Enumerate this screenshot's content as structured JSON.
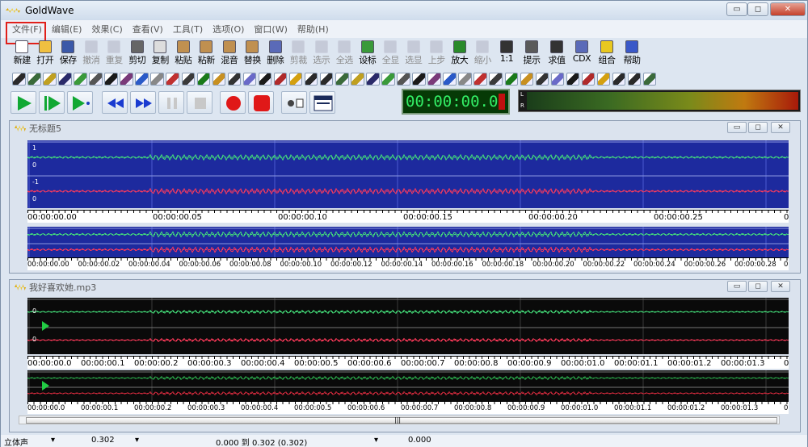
{
  "app": {
    "title": "GoldWave"
  },
  "window_controls": {
    "minimize": "▭",
    "restore": "◻",
    "close": "✕"
  },
  "menu": [
    "文件(F)",
    "编辑(E)",
    "效果(C)",
    "查看(V)",
    "工具(T)",
    "选项(O)",
    "窗口(W)",
    "帮助(H)"
  ],
  "toolbar": [
    {
      "label": "新建",
      "icon": "new-icon",
      "enabled": true
    },
    {
      "label": "打开",
      "icon": "open-icon",
      "enabled": true
    },
    {
      "label": "保存",
      "icon": "save-icon",
      "enabled": true
    },
    {
      "label": "撤消",
      "icon": "undo-icon",
      "enabled": false
    },
    {
      "label": "重复",
      "icon": "redo-icon",
      "enabled": false
    },
    {
      "label": "剪切",
      "icon": "cut-icon",
      "enabled": true
    },
    {
      "label": "复制",
      "icon": "copy-icon",
      "enabled": true
    },
    {
      "label": "粘贴",
      "icon": "paste-icon",
      "enabled": true
    },
    {
      "label": "粘新",
      "icon": "paste-new-icon",
      "enabled": true
    },
    {
      "label": "混音",
      "icon": "mix-icon",
      "enabled": true
    },
    {
      "label": "替换",
      "icon": "replace-icon",
      "enabled": true
    },
    {
      "label": "删除",
      "icon": "delete-icon",
      "enabled": true
    },
    {
      "label": "剪裁",
      "icon": "trim-icon",
      "enabled": false
    },
    {
      "label": "选示",
      "icon": "select-view-icon",
      "enabled": false
    },
    {
      "label": "全选",
      "icon": "select-all-icon",
      "enabled": false
    },
    {
      "label": "设标",
      "icon": "set-marker-icon",
      "enabled": true
    },
    {
      "label": "全显",
      "icon": "show-all-icon",
      "enabled": false
    },
    {
      "label": "选显",
      "icon": "show-selection-icon",
      "enabled": false
    },
    {
      "label": "上步",
      "icon": "previous-icon",
      "enabled": false
    },
    {
      "label": "放大",
      "icon": "zoom-in-icon",
      "enabled": true
    },
    {
      "label": "缩小",
      "icon": "zoom-out-icon",
      "enabled": false
    },
    {
      "label": "1:1",
      "icon": "zoom-1-1-icon",
      "enabled": true
    },
    {
      "label": "提示",
      "icon": "cue-icon",
      "enabled": true
    },
    {
      "label": "求值",
      "icon": "evaluate-icon",
      "enabled": true
    },
    {
      "label": "CDX",
      "icon": "cd-icon",
      "enabled": true
    },
    {
      "label": "组合",
      "icon": "combine-icon",
      "enabled": true
    },
    {
      "label": "帮助",
      "icon": "help-icon",
      "enabled": true
    }
  ],
  "effects_toolbar_count": 42,
  "timer": {
    "display": "00:00:00.0"
  },
  "meter": {
    "left": "L",
    "right": "R"
  },
  "windows": [
    {
      "title": "无标题5",
      "ch_labels": [
        "1",
        "0",
        "-1",
        "0"
      ],
      "ruler": [
        "00:00:00.00",
        "00:00:00.05",
        "00:00:00.10",
        "00:00:00.15",
        "00:00:00.20",
        "00:00:00.25",
        "0"
      ],
      "overview_ruler": [
        "00:00:00.00",
        "00:00:00.02",
        "00:00:00.04",
        "00:00:00.06",
        "00:00:00.08",
        "00:00:00.10",
        "00:00:00.12",
        "00:00:00.14",
        "00:00:00.16",
        "00:00:00.18",
        "00:00:00.20",
        "00:00:00.22",
        "00:00:00.24",
        "00:00:00.26",
        "00:00:00.28",
        "0"
      ]
    },
    {
      "title": "我好喜欢她.mp3",
      "ch_labels": [
        "0",
        "0"
      ],
      "ruler": [
        "00:00:00.0",
        "00:00:00.1",
        "00:00:00.2",
        "00:00:00.3",
        "00:00:00.4",
        "00:00:00.5",
        "00:00:00.6",
        "00:00:00.7",
        "00:00:00.8",
        "00:00:00.9",
        "00:00:01.0",
        "00:00:01.1",
        "00:00:01.2",
        "00:00:01.3",
        "0"
      ],
      "overview_ruler": [
        "00:00:00.0",
        "00:00:00.1",
        "00:00:00.2",
        "00:00:00.3",
        "00:00:00.4",
        "00:00:00.5",
        "00:00:00.6",
        "00:00:00.7",
        "00:00:00.8",
        "00:00:00.9",
        "00:00:01.0",
        "00:00:01.1",
        "00:00:01.2",
        "00:00:01.3",
        "0"
      ]
    }
  ],
  "status": {
    "channels": "立体声",
    "length": "0.302",
    "selection": "0.000 到 0.302 (0.302)",
    "position": "0.000"
  },
  "scroll_grip": "|||"
}
